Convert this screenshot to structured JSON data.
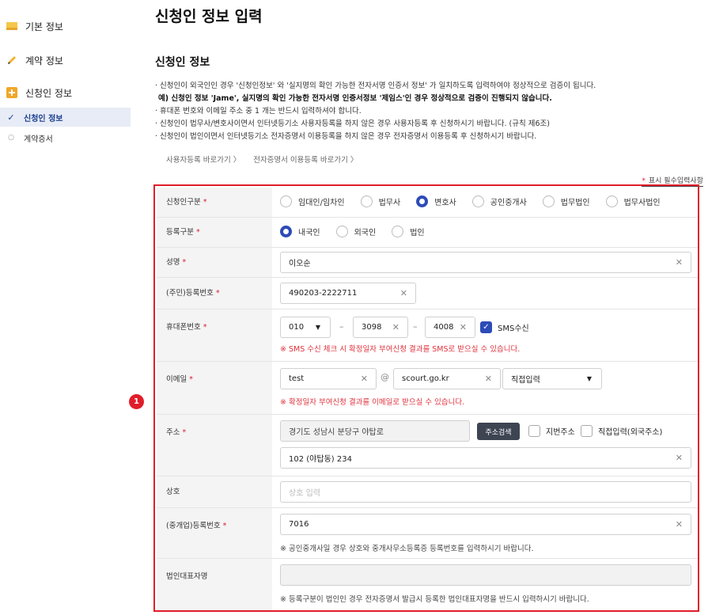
{
  "sidebar": {
    "items": [
      {
        "label": "기본 정보",
        "icon": "folder-icon"
      },
      {
        "label": "계약 정보",
        "icon": "pen-icon"
      },
      {
        "label": "신청인 정보",
        "icon": "plus-box-icon"
      }
    ],
    "sub_items": [
      {
        "label": "신청인 정보",
        "active": true
      },
      {
        "label": "계약증서",
        "active": false
      }
    ]
  },
  "page": {
    "title": "신청인 정보 입력",
    "section_title": "신청인 정보",
    "notes": [
      "· 신청인이 외국인인 경우 '신청인정보' 와 '실지명의 확인 가능한 전자서명 인증서 정보' 가 일치하도록 입력하여야 정상적으로 검증이 됩니다.",
      "예) 신청인 정보 'Jame', 실지명의 확인 가능한 전자서명 인증서정보 '제임스'인 경우 정상적으로 검증이 진행되지 않습니다.",
      "· 휴대폰 번호와 이메일 주소 중 1 개는 반드시 입력하셔야 합니다.",
      "· 신청인이 법무사/변호사이면서 인터넷등기소 사용자등록을 하지 않은 경우 사용자등록 후 신청하시기 바랍니다. (규칙 제6조)",
      "· 신청인이 법인이면서 인터넷등기소 전자증명서 이용등록을 하지 않은 경우 전자증명서 이용등록 후 신청하시기 바랍니다."
    ],
    "links": [
      "사용자등록 바로가기 〉",
      "전자증명서 이용등록 바로가기 〉"
    ],
    "required_legend": "표시 필수입력사항",
    "required_star": "*",
    "badge": "1"
  },
  "form": {
    "applicant_type": {
      "label": "신청인구분",
      "options": [
        "임대인/임차인",
        "법무사",
        "변호사",
        "공인중개사",
        "법무법인",
        "법무사법인"
      ],
      "selected": "변호사"
    },
    "registration_type": {
      "label": "등록구분",
      "options": [
        "내국인",
        "외국인",
        "법인"
      ],
      "selected": "내국인"
    },
    "name": {
      "label": "성명",
      "value": "이오순"
    },
    "resident_number": {
      "label": "(주민)등록번호",
      "value": "490203-2222711"
    },
    "mobile": {
      "label": "휴대폰번호",
      "prefix": "010",
      "middle": "3098",
      "last": "4008",
      "dash": "–",
      "sms_label": "SMS수신",
      "hint": "※ SMS 수신 체크 시 확정일자 부여신청 결과를 SMS로 받으실 수 있습니다."
    },
    "email": {
      "label": "이메일",
      "local": "test",
      "at": "@",
      "domain": "scourt.go.kr",
      "domain_select": "직접입력",
      "hint": "※ 확정일자 부여신청 결과를 이메일로 받으실 수 있습니다."
    },
    "address": {
      "label": "주소",
      "road": "경기도 성남시 분당구 야탑로",
      "search_button": "주소검색",
      "lot_label": "지번주소",
      "direct_label": "직접입력(외국주소)",
      "detail": "102 (야탑동) 234"
    },
    "business_name": {
      "label": "상호",
      "placeholder": "상호 입력"
    },
    "business_reg_number": {
      "label": "(중개업)등록번호",
      "value": "7016",
      "hint": "※ 공인중개사일 경우 상호와 중개사무소등록증 등록번호를 입력하시기 바랍니다."
    },
    "corp_rep": {
      "label": "법인대표자명",
      "hint": "※ 등록구분이 법인인 경우 전자증명서 발급시 등록한 법인대표자명을 반드시 입력하시기 바랍니다."
    }
  },
  "colors": {
    "accent": "#2d4bb8",
    "required": "#d91c2a",
    "frame": "#e11d2a",
    "hint_red": "#e0313c"
  }
}
